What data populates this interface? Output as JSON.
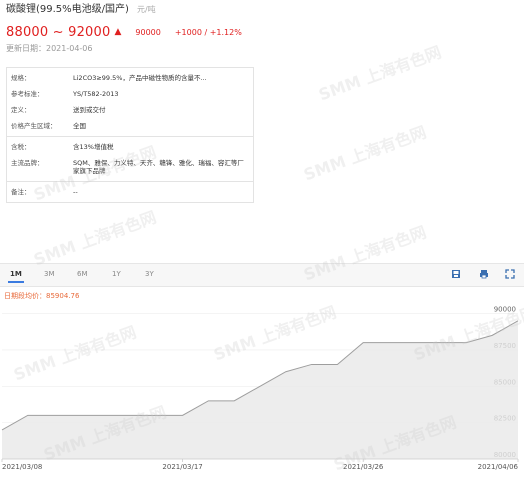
{
  "header": {
    "title": "碳酸锂(99.5%电池级/国产)",
    "unit": "元/吨",
    "price_range": "88000 ~ 92000",
    "avg_price": "90000",
    "change": "+1000 / +1.12%",
    "updated": "更新日期：2021-04-06"
  },
  "info": {
    "section1": [
      {
        "k": "规格：",
        "v": "Li2CO3≥99.5%，产品中磁性物质的含量不..."
      },
      {
        "k": "参考标准：",
        "v": "YS/T582-2013"
      },
      {
        "k": "定义：",
        "v": "送到或交付"
      },
      {
        "k": "价格产生区域：",
        "v": "全国"
      }
    ],
    "section2": [
      {
        "k": "含税：",
        "v": "含13%增值税"
      },
      {
        "k": "主流品牌：",
        "v": "SQM、雅保、力义特、天齐、赣锋、雅化、瑞福、容汇等厂家旗下品牌"
      }
    ],
    "section3": [
      {
        "k": "备注：",
        "v": "--"
      }
    ]
  },
  "tabs": [
    "1M",
    "3M",
    "6M",
    "1Y",
    "3Y"
  ],
  "active_tab": "1M",
  "avg_label": "日期段均价：85904.76",
  "watermark": "SMM 上海有色网",
  "colors": {
    "line": "#9e9e9e",
    "area": "#e8e8e8",
    "red": "#e02020",
    "accent": "#3b7be0"
  },
  "chart_data": {
    "type": "area",
    "x": [
      "2021/03/08",
      "2021/03/09",
      "2021/03/10",
      "2021/03/11",
      "2021/03/12",
      "2021/03/15",
      "2021/03/16",
      "2021/03/17",
      "2021/03/18",
      "2021/03/19",
      "2021/03/22",
      "2021/03/23",
      "2021/03/24",
      "2021/03/25",
      "2021/03/26",
      "2021/03/29",
      "2021/03/30",
      "2021/03/31",
      "2021/04/01",
      "2021/04/02",
      "2021/04/06"
    ],
    "y": [
      82000,
      83000,
      83000,
      83000,
      83000,
      83000,
      83000,
      83000,
      84000,
      84000,
      85000,
      86000,
      86500,
      86500,
      88000,
      88000,
      88000,
      88000,
      88000,
      88500,
      89500
    ],
    "xticks": [
      "2021/03/08",
      "2021/03/17",
      "2021/03/26",
      "2021/04/06"
    ],
    "yticks": [
      80000,
      82500,
      85000,
      87500,
      90000
    ],
    "ylim": [
      80000,
      91000
    ]
  }
}
